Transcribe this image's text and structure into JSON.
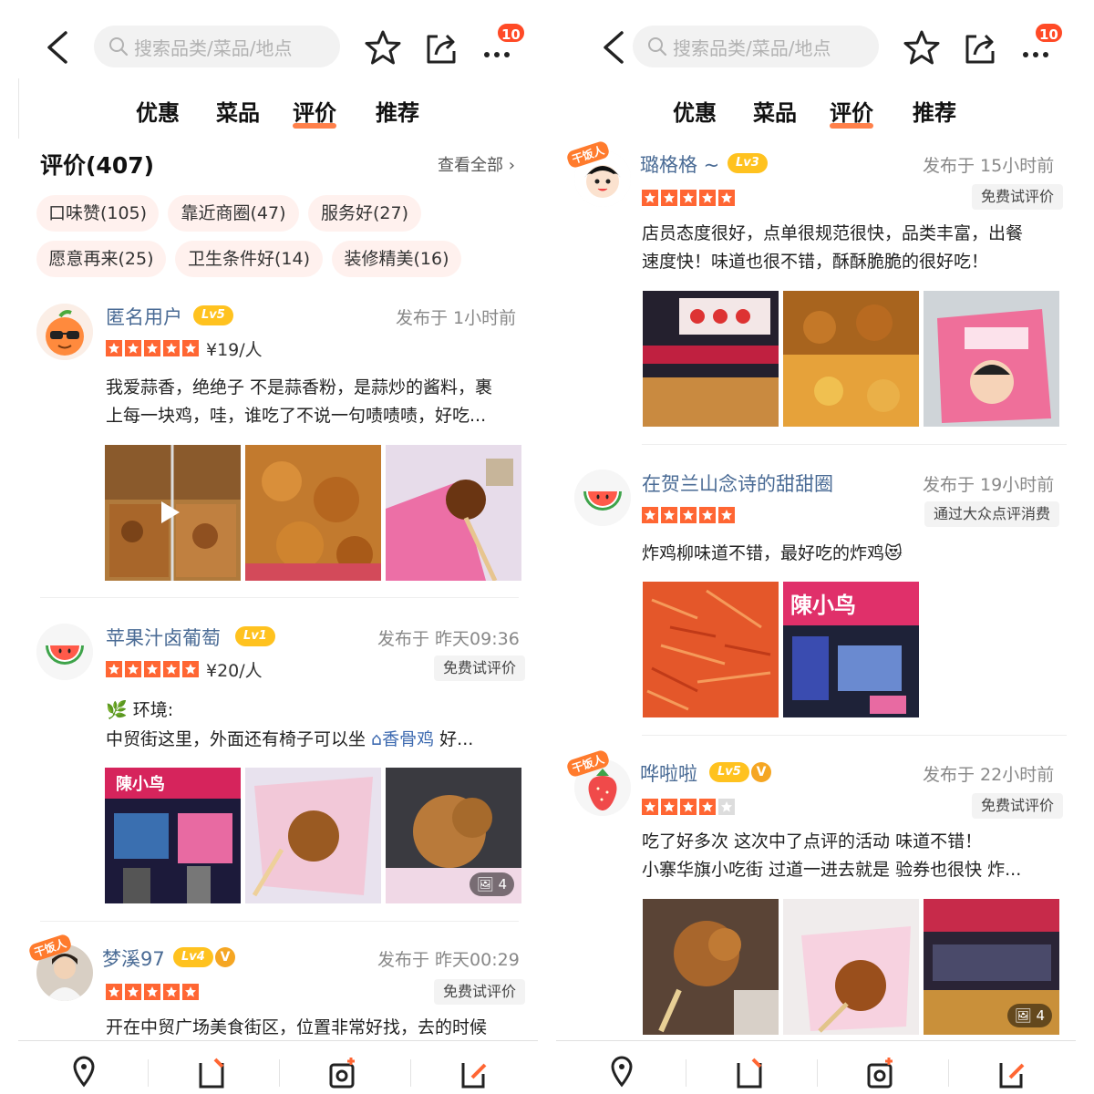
{
  "topbar": {
    "search_placeholder": "搜索品类/菜品/地点",
    "badge_count": "10"
  },
  "tabs": [
    "优惠",
    "菜品",
    "评价",
    "推荐"
  ],
  "active_tab": "评价",
  "summary": {
    "title": "评价(407)",
    "view_all": "查看全部"
  },
  "tags": [
    "口味赞(105)",
    "靠近商圈(47)",
    "服务好(27)",
    "愿意再来(25)",
    "卫生条件好(14)",
    "装修精美(16)"
  ],
  "reviews_left": [
    {
      "name": "匿名用户",
      "level": "Lv5",
      "time": "发布于 1小时前",
      "rating": 5,
      "price": "¥19/人",
      "line1": "我爱蒜香，绝绝子 不是蒜香粉，是蒜炒的酱料，裹",
      "line2": "上每一块鸡，哇，谁吃了不说一句啧啧啧，好吃..."
    },
    {
      "name": "苹果汁卤葡萄",
      "level": "Lv1",
      "time": "发布于 昨天09:36",
      "rating": 5,
      "price": "¥20/人",
      "tag": "免费试评价",
      "line1": "🌿 环境:",
      "line2_pre": "中贸街这里，外面还有椅子可以坐 ",
      "line2_mention": "⌂香骨鸡",
      "line2_post": " 好...",
      "photo_count": "4"
    },
    {
      "name": "梦溪97",
      "level": "Lv4",
      "verified": "V",
      "time": "发布于 昨天00:29",
      "rating": 5,
      "tag": "免费试评价",
      "line1": "开在中贸广场美食街区，位置非常好找，去的时候"
    }
  ],
  "reviews_right": [
    {
      "name": "璐格格 ~",
      "level": "Lv3",
      "time": "发布于 15小时前",
      "rating": 5,
      "tag": "免费试评价",
      "line1": "店员态度很好，点单很规范很快，品类丰富，出餐",
      "line2": "速度快！味道也很不错，酥酥脆脆的很好吃！"
    },
    {
      "name": "在贺兰山念诗的甜甜圈",
      "time": "发布于 19小时前",
      "rating": 5,
      "tag": "通过大众点评消费",
      "line1": "炸鸡柳味道不错，最好吃的炸鸡😻"
    },
    {
      "name": "哗啦啦",
      "level": "Lv5",
      "verified": "V",
      "time": "发布于 22小时前",
      "rating": 4,
      "tag": "免费试评价",
      "line1": "吃了好多次 这次中了点评的活动 味道不错！",
      "line2": "小寨华旗小吃街 过道一进去就是 验券也很快 炸...",
      "photo_count": "4"
    }
  ],
  "sticker_text": "干饭人",
  "photo_signs": {
    "left_r2_p1": "陳小鸟",
    "right_r2_p2": "陳小鸟"
  },
  "colors": {
    "accent": "#ff6633",
    "name_blue": "#4a6b95",
    "level_yellow": "#ffc21f",
    "chip_bg": "#fff1ee"
  }
}
